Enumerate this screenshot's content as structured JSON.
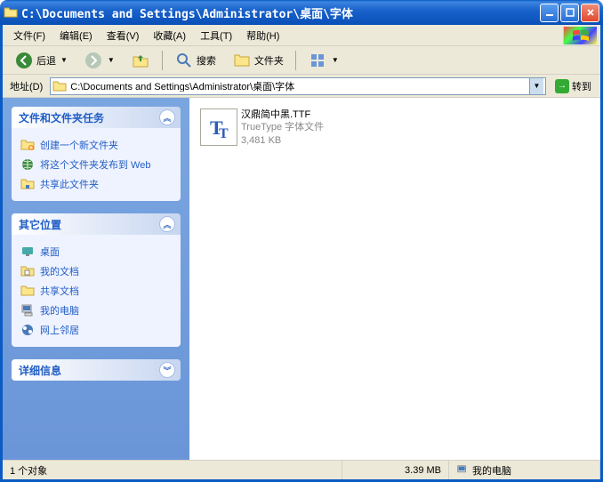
{
  "title": "C:\\Documents and Settings\\Administrator\\桌面\\字体",
  "menu": {
    "file": "文件(F)",
    "edit": "编辑(E)",
    "view": "查看(V)",
    "favorites": "收藏(A)",
    "tools": "工具(T)",
    "help": "帮助(H)"
  },
  "toolbar": {
    "back": "后退",
    "search": "搜索",
    "folders": "文件夹"
  },
  "address": {
    "label": "地址(D)",
    "value": "C:\\Documents and Settings\\Administrator\\桌面\\字体",
    "go": "转到"
  },
  "sidebar": {
    "panels": [
      {
        "title": "文件和文件夹任务",
        "expanded": true,
        "tasks": [
          {
            "icon": "new-folder",
            "label": "创建一个新文件夹"
          },
          {
            "icon": "publish",
            "label": "将这个文件夹发布到 Web"
          },
          {
            "icon": "share",
            "label": "共享此文件夹"
          }
        ]
      },
      {
        "title": "其它位置",
        "expanded": true,
        "tasks": [
          {
            "icon": "desktop",
            "label": "桌面"
          },
          {
            "icon": "mydocs",
            "label": "我的文档"
          },
          {
            "icon": "shared",
            "label": "共享文档"
          },
          {
            "icon": "mycomputer",
            "label": "我的电脑"
          },
          {
            "icon": "network",
            "label": "网上邻居"
          }
        ]
      },
      {
        "title": "详细信息",
        "expanded": false,
        "tasks": []
      }
    ]
  },
  "files": [
    {
      "name": "汉鼎简中黑.TTF",
      "type": "TrueType 字体文件",
      "size": "3,481 KB"
    }
  ],
  "status": {
    "objects": "1 个对象",
    "size": "3.39 MB",
    "location": "我的电脑"
  }
}
